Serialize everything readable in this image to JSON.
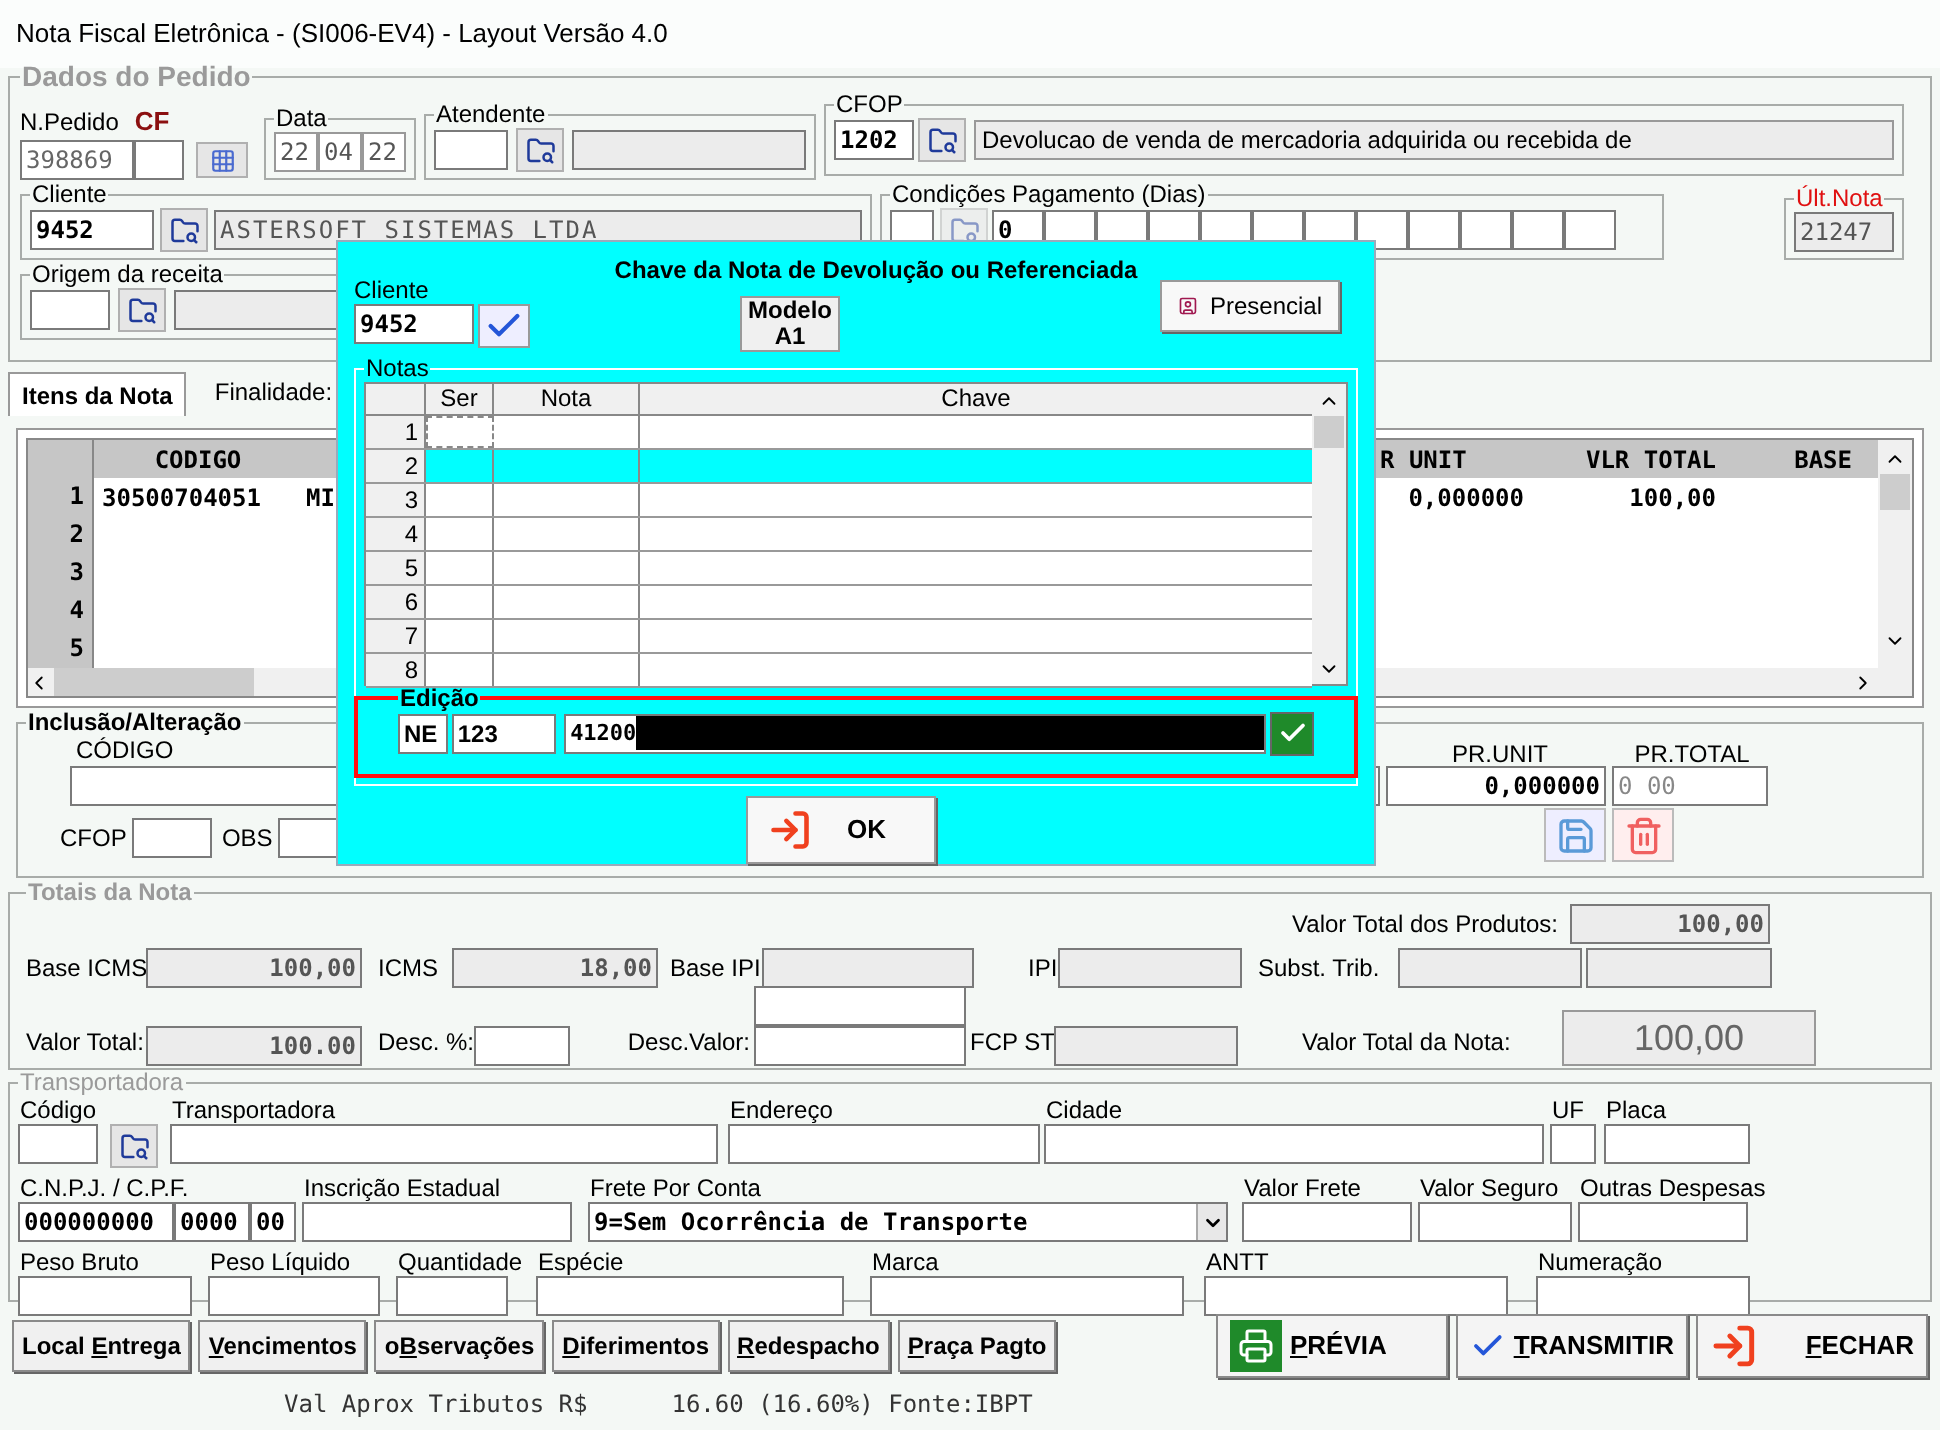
{
  "window": {
    "title": "Nota Fiscal Eletrônica - (SI006-EV4) - Layout Versão 4.0"
  },
  "dados_pedido": {
    "legend": "Dados do Pedido",
    "n_pedido": {
      "label": "N.Pedido",
      "tag": "CF",
      "value": "398869"
    },
    "data": {
      "label": "Data",
      "parts": [
        "22",
        "04",
        "22"
      ]
    },
    "atendente": {
      "label": "Atendente"
    },
    "cfop": {
      "label": "CFOP",
      "code": "1202",
      "description": "Devolucao de venda de mercadoria adquirida ou recebida de"
    },
    "cliente": {
      "label": "Cliente",
      "code": "9452",
      "name": "ASTERSOFT SISTEMAS LTDA"
    },
    "condicoes": {
      "label": "Condições Pagamento (Dias)",
      "first_day": "0"
    },
    "ult_nota": {
      "label": "Últ.Nota",
      "value": "21247"
    },
    "origem": {
      "label": "Origem da receita"
    }
  },
  "tabs": [
    {
      "label": "Itens da Nota",
      "selected": true
    }
  ],
  "finalidade": {
    "label": "Finalidade:"
  },
  "items": {
    "columns": [
      "CODIGO",
      "R UNIT",
      "VLR TOTAL",
      "BASE"
    ],
    "row_numbers": [
      "1",
      "2",
      "3",
      "4",
      "5"
    ],
    "rows": [
      {
        "codigo": "30500704051",
        "descricao": "MI",
        "vlr_unit": "0,000000",
        "vlr_total": "100,00"
      }
    ]
  },
  "inclusao": {
    "legend": "Inclusão/Alteração",
    "codigo_label": "CÓDIGO",
    "cfop_label": "CFOP",
    "obs_label": "OBS",
    "pr_unit": {
      "label": "PR.UNIT",
      "value": "0,000000"
    },
    "pr_total": {
      "label": "PR.TOTAL",
      "value": "0 00"
    }
  },
  "totais": {
    "legend": "Totais da Nota",
    "valor_produtos": {
      "label": "Valor Total dos Produtos:",
      "value": "100,00"
    },
    "base_icms": {
      "label": "Base ICMS",
      "value": "100,00"
    },
    "icms": {
      "label": "ICMS",
      "value": "18,00"
    },
    "base_ipi": {
      "label": "Base IPI"
    },
    "ipi": {
      "label": "IPI"
    },
    "subst_trib": {
      "label": "Subst. Trib."
    },
    "valor_total": {
      "label": "Valor Total:",
      "value": "100.00"
    },
    "desc_pct": {
      "label": "Desc. %:"
    },
    "desc_valor": {
      "label": "Desc.Valor:"
    },
    "fcp_st": {
      "label": "FCP ST"
    },
    "valor_nota": {
      "label": "Valor Total da Nota:",
      "value": "100,00"
    }
  },
  "transportadora": {
    "legend": "Transportadora",
    "rows": [
      [
        {
          "kind": "lookup",
          "label": "Código"
        },
        {
          "kind": "text",
          "label": "Transportadora"
        },
        {
          "kind": "text",
          "label": "Endereço"
        },
        {
          "kind": "text",
          "label": "Cidade"
        },
        {
          "kind": "text",
          "label": "UF"
        },
        {
          "kind": "text",
          "label": "Placa"
        }
      ],
      [
        {
          "kind": "cnpj",
          "label": "C.N.P.J. / C.P.F.",
          "parts": [
            "000000000",
            "0000",
            "00"
          ]
        },
        {
          "kind": "text",
          "label": "Inscrição Estadual"
        },
        {
          "kind": "select",
          "label": "Frete Por Conta",
          "value": "9=Sem Ocorrência de Transporte"
        },
        {
          "kind": "text",
          "label": "Valor Frete"
        },
        {
          "kind": "text",
          "label": "Valor Seguro"
        },
        {
          "kind": "text",
          "label": "Outras Despesas"
        }
      ],
      [
        {
          "kind": "text",
          "label": "Peso Bruto"
        },
        {
          "kind": "text",
          "label": "Peso Líquido"
        },
        {
          "kind": "text",
          "label": "Quantidade"
        },
        {
          "kind": "text",
          "label": "Espécie"
        },
        {
          "kind": "text",
          "label": "Marca"
        },
        {
          "kind": "text",
          "label": "ANTT"
        },
        {
          "kind": "text",
          "label": "Numeração"
        }
      ]
    ]
  },
  "buttons": [
    {
      "pre": "Local ",
      "key": "E",
      "post": "ntrega"
    },
    {
      "key": "V",
      "post": "encimentos"
    },
    {
      "pre": "o",
      "key": "B",
      "post": "servações"
    },
    {
      "key": "D",
      "post": "iferimentos"
    },
    {
      "key": "R",
      "post": "edespacho"
    },
    {
      "key": "P",
      "post": "raça Pagto"
    }
  ],
  "actions": [
    {
      "kind": "print",
      "key": "P",
      "post": "RÉVIA"
    },
    {
      "kind": "check",
      "key": "T",
      "post": "RANSMITIR"
    },
    {
      "kind": "exit",
      "key": "F",
      "post": "ECHAR"
    }
  ],
  "footer": {
    "label": "Val Aprox Tributos R$",
    "value": "16.60 (16.60%) Fonte:IBPT"
  },
  "dialog": {
    "title": "Chave da Nota de Devolução ou  Referenciada",
    "cliente": {
      "label": "Cliente",
      "value": "9452"
    },
    "modelo": {
      "label": "Modelo",
      "value": "A1"
    },
    "presencial": "Presencial",
    "notas": {
      "legend": "Notas",
      "columns": [
        "Ser",
        "Nota",
        "Chave"
      ],
      "rows": [
        {
          "number": "1",
          "selected": false,
          "focused": true
        },
        {
          "number": "2",
          "selected": true,
          "focused": false
        },
        {
          "number": "3",
          "selected": false,
          "focused": false
        },
        {
          "number": "4",
          "selected": false,
          "focused": false
        },
        {
          "number": "5",
          "selected": false,
          "focused": false
        },
        {
          "number": "6",
          "selected": false,
          "focused": false
        },
        {
          "number": "7",
          "selected": false,
          "focused": false
        },
        {
          "number": "8",
          "selected": false,
          "focused": false
        }
      ]
    },
    "edicao": {
      "legend": "Edição",
      "ser": "NE",
      "nota": "123",
      "chave": "41200"
    },
    "ok": "OK"
  }
}
